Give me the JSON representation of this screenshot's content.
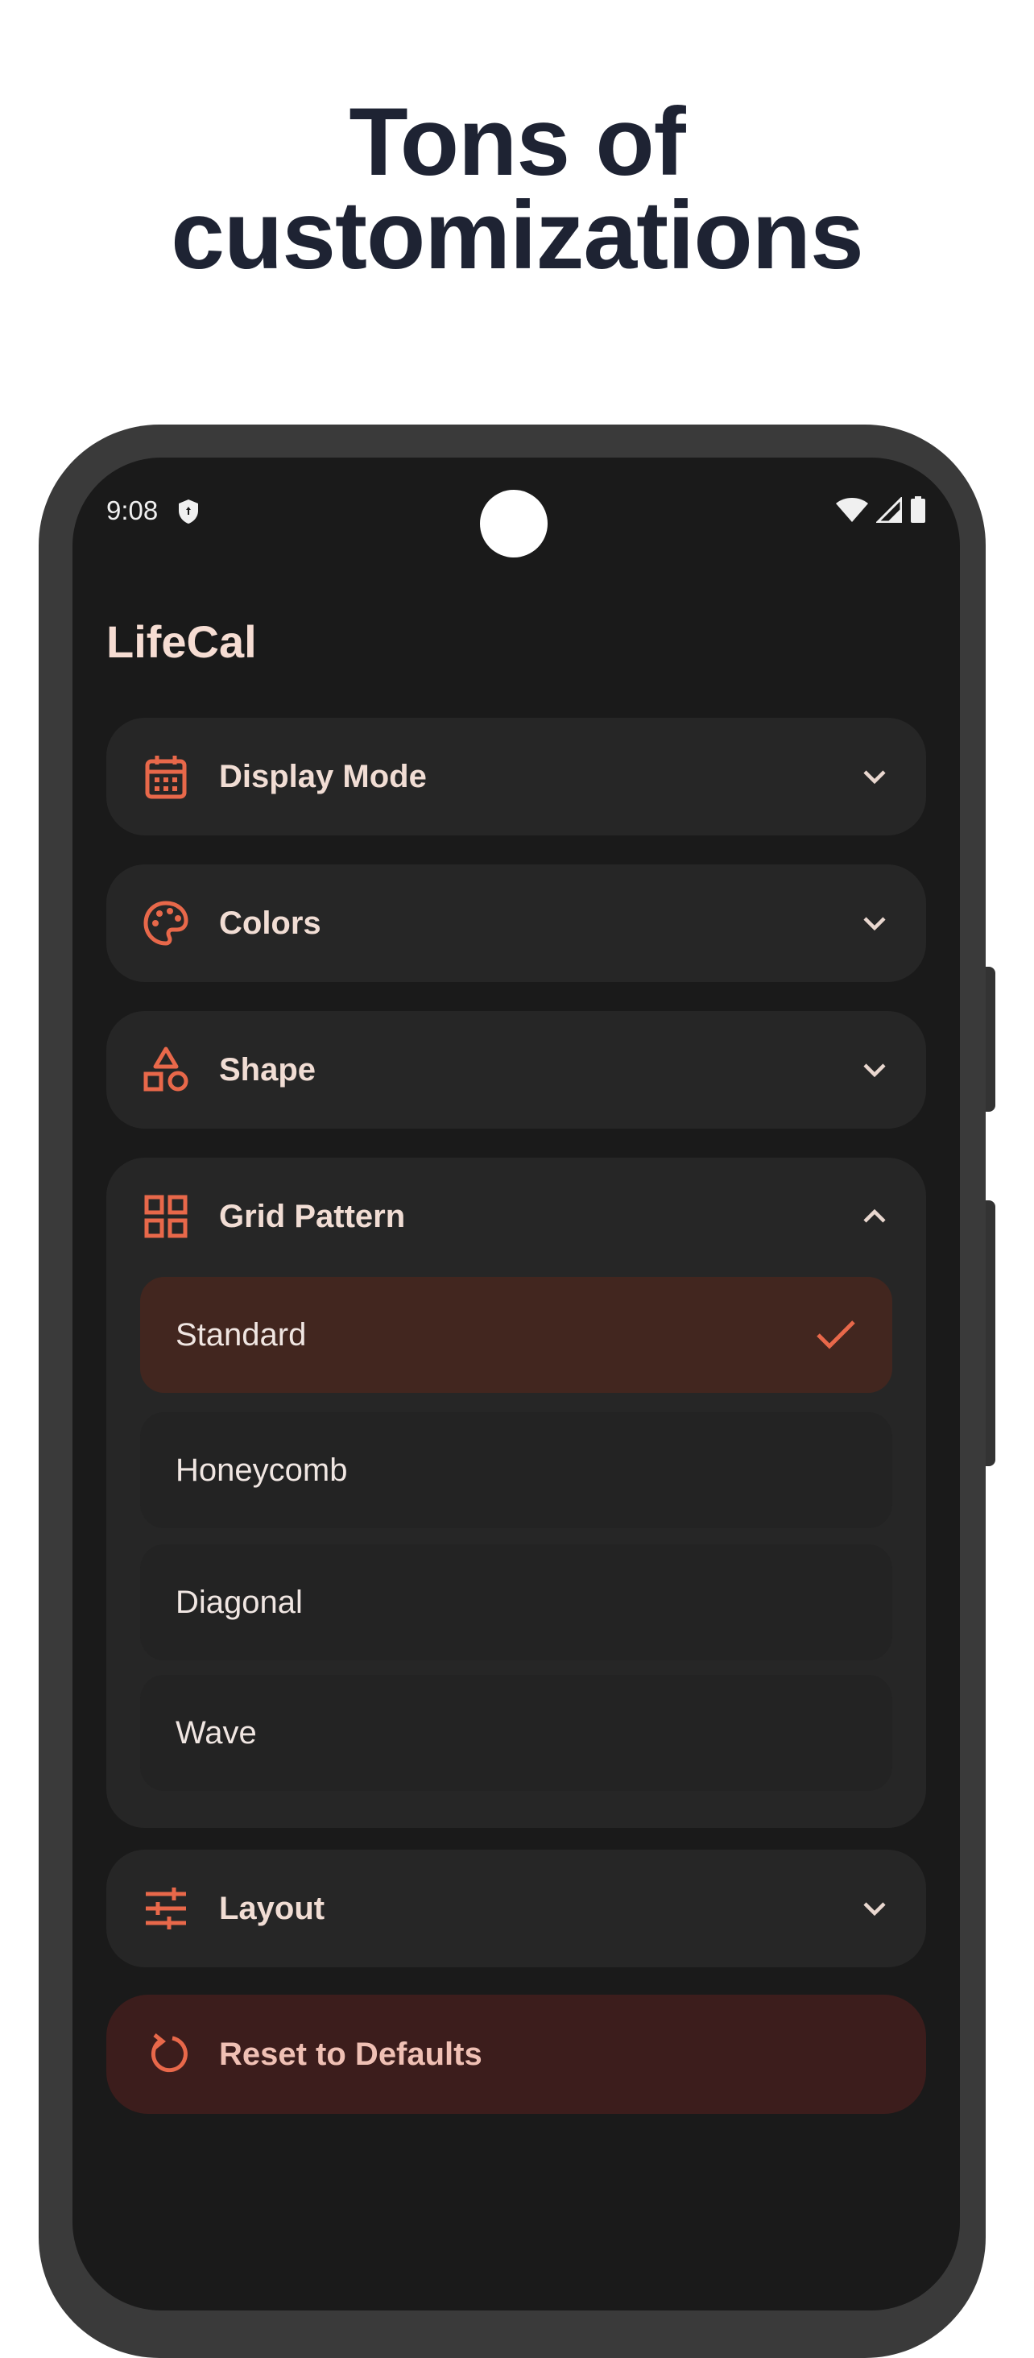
{
  "headline": {
    "line1": "Tons of",
    "line2": "customizations"
  },
  "status_bar": {
    "time": "9:08"
  },
  "app": {
    "title": "LifeCal"
  },
  "sections": [
    {
      "label": "Display Mode",
      "icon": "calendar-icon",
      "expanded": false
    },
    {
      "label": "Colors",
      "icon": "palette-icon",
      "expanded": false
    },
    {
      "label": "Shape",
      "icon": "shapes-icon",
      "expanded": false
    },
    {
      "label": "Grid Pattern",
      "icon": "grid-icon",
      "expanded": true
    },
    {
      "label": "Layout",
      "icon": "tune-icon",
      "expanded": false
    }
  ],
  "grid_pattern": {
    "options": [
      {
        "label": "Standard",
        "selected": true
      },
      {
        "label": "Honeycomb",
        "selected": false
      },
      {
        "label": "Diagonal",
        "selected": false
      },
      {
        "label": "Wave",
        "selected": false
      }
    ]
  },
  "reset": {
    "label": "Reset to Defaults",
    "icon": "reset-icon"
  },
  "colors": {
    "accent": "#e8684a",
    "background": "#1a1a1a",
    "card": "#262626"
  }
}
